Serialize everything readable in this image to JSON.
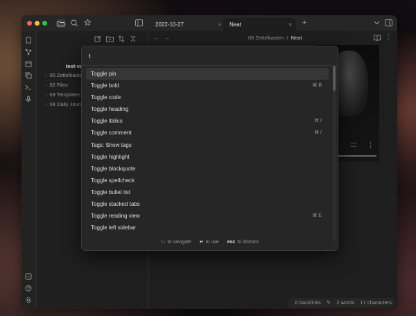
{
  "window": {
    "traffic_lights": [
      "#ff5f57",
      "#febc2e",
      "#28c840"
    ]
  },
  "tabs": [
    {
      "label": "2022-10-27",
      "close": "×"
    },
    {
      "label": "Neat",
      "close": "×"
    }
  ],
  "new_tab": "+",
  "header_icons": {
    "files": "folder-icon",
    "search": "search-icon",
    "bookmarks": "star-icon",
    "sidebar_toggle": "sidebar-toggle-icon"
  },
  "breadcrumb": {
    "folder": "00 Zettelkasten",
    "sep": "/",
    "note": "Neat"
  },
  "nav": {
    "back": "←",
    "forward": "→"
  },
  "vault": {
    "name": "test-vault"
  },
  "file_tree": [
    {
      "label": "00 Zettelkasten"
    },
    {
      "label": "02 Files"
    },
    {
      "label": "03 Templates"
    },
    {
      "label": "04 Daily Journal"
    }
  ],
  "palette": {
    "query": "t",
    "items": [
      {
        "label": "Toggle pin",
        "hotkey": ""
      },
      {
        "label": "Toggle bold",
        "hotkey": "⌘ B"
      },
      {
        "label": "Toggle code",
        "hotkey": ""
      },
      {
        "label": "Toggle heading",
        "hotkey": ""
      },
      {
        "label": "Toggle italics",
        "hotkey": "⌘ I"
      },
      {
        "label": "Toggle comment",
        "hotkey": "⌘ /"
      },
      {
        "label": "Tags: Show tags",
        "hotkey": ""
      },
      {
        "label": "Toggle highlight",
        "hotkey": ""
      },
      {
        "label": "Toggle blockquote",
        "hotkey": ""
      },
      {
        "label": "Toggle spellcheck",
        "hotkey": ""
      },
      {
        "label": "Toggle bullet list",
        "hotkey": ""
      },
      {
        "label": "Toggle stacked tabs",
        "hotkey": ""
      },
      {
        "label": "Toggle reading view",
        "hotkey": "⌘ E"
      },
      {
        "label": "Toggle left sidebar",
        "hotkey": ""
      }
    ],
    "instructions": [
      {
        "key": "↑↓",
        "text": "to navigate"
      },
      {
        "key": "↵",
        "text": "to use"
      },
      {
        "key": "esc",
        "text": "to dismiss"
      }
    ]
  },
  "status_bar": {
    "backlinks": "0 backlinks",
    "words": "2 words",
    "characters": "17 characters"
  }
}
